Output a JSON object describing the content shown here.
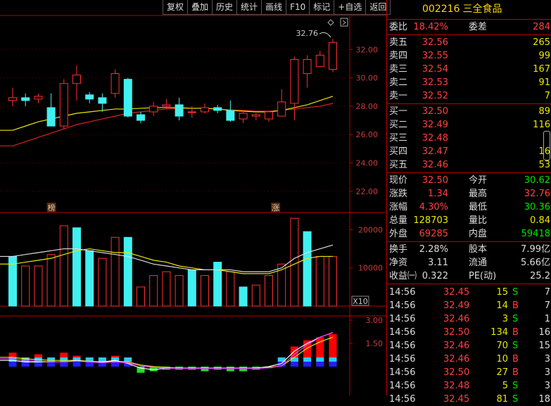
{
  "toolbar": [
    "复权",
    "叠加",
    "历史",
    "统计",
    "画线",
    "F10",
    "标记",
    "+自选",
    "返回"
  ],
  "price_chart": {
    "axis_labels": [
      "32.00",
      "30.00",
      "28.00",
      "26.00",
      "24.00",
      "22.00"
    ],
    "high_marker": "32.76",
    "badges": [
      "榜",
      "涨"
    ],
    "candles": [
      [
        28.4,
        28.6,
        28.0,
        29.3
      ],
      [
        28.6,
        28.4,
        28.0,
        28.9
      ],
      [
        28.5,
        28.7,
        28.2,
        28.9
      ],
      [
        27.9,
        26.6,
        26.6,
        28.9
      ],
      [
        26.6,
        29.6,
        26.4,
        29.9
      ],
      [
        29.6,
        30.2,
        28.4,
        30.9
      ],
      [
        28.8,
        28.5,
        28.2,
        29.0
      ],
      [
        28.6,
        28.2,
        27.6,
        28.9
      ],
      [
        28.9,
        30.3,
        28.6,
        30.6
      ],
      [
        29.9,
        27.3,
        27.2,
        30.0
      ],
      [
        27.4,
        27.0,
        26.8,
        27.6
      ],
      [
        27.6,
        28.0,
        27.3,
        28.3
      ],
      [
        28.0,
        28.1,
        27.8,
        28.5
      ],
      [
        28.1,
        27.3,
        27.0,
        28.6
      ],
      [
        27.6,
        27.6,
        27.2,
        28.0
      ],
      [
        27.6,
        27.9,
        27.5,
        28.2
      ],
      [
        27.9,
        27.7,
        27.5,
        28.1
      ],
      [
        27.7,
        27.0,
        26.9,
        28.4
      ],
      [
        27.1,
        27.5,
        26.8,
        27.7
      ],
      [
        27.3,
        27.4,
        27.0,
        27.5
      ],
      [
        27.1,
        27.6,
        26.9,
        27.6
      ],
      [
        27.3,
        28.3,
        27.3,
        29.2
      ],
      [
        28.2,
        31.3,
        27.0,
        31.5
      ],
      [
        30.3,
        31.3,
        29.3,
        31.6
      ],
      [
        30.8,
        31.6,
        30.8,
        31.9
      ],
      [
        30.6,
        32.5,
        30.4,
        32.76
      ]
    ],
    "ma_yellow": [
      26.3,
      26.6,
      26.9,
      27.1,
      27.3,
      27.5,
      27.6,
      27.7,
      27.8,
      27.8,
      27.85,
      27.9,
      27.9,
      27.9,
      27.85,
      27.85,
      27.8,
      27.7,
      27.65,
      27.6,
      27.6,
      27.7,
      27.9,
      28.1,
      28.4,
      28.7
    ],
    "ma_red": [
      25.2,
      25.5,
      25.8,
      26.1,
      26.4,
      26.7,
      26.9,
      27.1,
      27.3,
      27.5,
      27.6,
      27.7,
      27.8,
      27.85,
      27.85,
      27.85,
      27.8,
      27.75,
      27.7,
      27.65,
      27.65,
      27.7,
      27.8,
      27.9,
      28.0,
      28.2
    ]
  },
  "volume_chart": {
    "axis_labels": [
      "20000",
      "10000"
    ],
    "unit": "X10",
    "bars": [
      [
        13000,
        "down"
      ],
      [
        10500,
        "up"
      ],
      [
        10500,
        "up"
      ],
      [
        13500,
        "up"
      ],
      [
        21000,
        "up"
      ],
      [
        20500,
        "down"
      ],
      [
        14500,
        "down"
      ],
      [
        12500,
        "up"
      ],
      [
        18000,
        "up"
      ],
      [
        18000,
        "down"
      ],
      [
        5000,
        "up"
      ],
      [
        8000,
        "up"
      ],
      [
        9000,
        "up"
      ],
      [
        8000,
        "up"
      ],
      [
        9500,
        "down"
      ],
      [
        8000,
        "up"
      ],
      [
        11500,
        "down"
      ],
      [
        9000,
        "up"
      ],
      [
        5000,
        "down"
      ],
      [
        5500,
        "up"
      ],
      [
        8000,
        "up"
      ],
      [
        11000,
        "up"
      ],
      [
        23000,
        "up"
      ],
      [
        19500,
        "down"
      ],
      [
        13000,
        "up"
      ],
      [
        13000,
        "up"
      ]
    ],
    "ma_yellow": [
      11000,
      11500,
      12000,
      12500,
      13500,
      14500,
      15000,
      14500,
      14000,
      14000,
      13000,
      12000,
      11500,
      10500,
      10000,
      9500,
      9500,
      9000,
      8500,
      8500,
      8500,
      9500,
      11000,
      12500,
      13000,
      13000
    ],
    "ma_white": [
      13000,
      13500,
      14000,
      14500,
      15000,
      15000,
      14500,
      14000,
      13500,
      13000,
      12000,
      11000,
      10500,
      10000,
      9500,
      9500,
      9500,
      9500,
      9000,
      9000,
      9000,
      10000,
      12500,
      14000,
      15000,
      16000
    ]
  },
  "macd_chart": {
    "axis_labels": [
      "3.00",
      "1.50"
    ],
    "hist": [
      0.9,
      0.5,
      0.8,
      0.2,
      0.9,
      0.7,
      0.2,
      0.5,
      0.7,
      0.3,
      -0.4,
      -0.3,
      -0.2,
      -0.2,
      -0.2,
      -0.3,
      -0.2,
      -0.3,
      -0.3,
      -0.2,
      -0.1,
      0.2,
      1.3,
      1.7,
      1.9,
      2.1
    ],
    "line_white": [
      0.4,
      0.3,
      0.3,
      0.3,
      0.3,
      0.4,
      0.3,
      0.3,
      0.4,
      0.2,
      -0.1,
      -0.2,
      -0.1,
      -0.1,
      -0.1,
      -0.1,
      -0.1,
      -0.1,
      -0.1,
      -0.1,
      0.0,
      0.2,
      1.0,
      1.5,
      1.9,
      2.2
    ],
    "line_yellow": [
      0.6,
      0.5,
      0.45,
      0.4,
      0.4,
      0.4,
      0.35,
      0.3,
      0.35,
      0.3,
      0.1,
      0.0,
      -0.05,
      -0.1,
      -0.1,
      -0.1,
      -0.1,
      -0.1,
      -0.1,
      -0.1,
      -0.05,
      0.05,
      0.6,
      1.2,
      1.6,
      1.9
    ],
    "line_mag": [
      0.5,
      0.4,
      0.35,
      0.3,
      0.3,
      0.35,
      0.3,
      0.25,
      0.3,
      0.25,
      0.05,
      -0.05,
      -0.1,
      -0.12,
      -0.12,
      -0.12,
      -0.12,
      -0.12,
      -0.12,
      -0.12,
      -0.08,
      0.05,
      0.8,
      1.4,
      1.9,
      2.2
    ]
  },
  "panel": {
    "code": "002216",
    "name": "三全食品",
    "weibi": {
      "label": "委比",
      "value": "18.42%",
      "label2": "委差",
      "value2": "284"
    },
    "asks": [
      {
        "label": "卖五",
        "price": "32.56",
        "vol": "265"
      },
      {
        "label": "卖四",
        "price": "32.55",
        "vol": "99"
      },
      {
        "label": "卖三",
        "price": "32.54",
        "vol": "167"
      },
      {
        "label": "卖二",
        "price": "32.53",
        "vol": "91"
      },
      {
        "label": "卖一",
        "price": "32.52",
        "vol": "7"
      }
    ],
    "bids": [
      {
        "label": "买一",
        "price": "32.50",
        "vol": "89"
      },
      {
        "label": "买二",
        "price": "32.49",
        "vol": "116"
      },
      {
        "label": "买三",
        "price": "32.48",
        "vol": ""
      },
      {
        "label": "买四",
        "price": "32.47",
        "vol": "16"
      },
      {
        "label": "买五",
        "price": "32.46",
        "vol": "53"
      }
    ],
    "quote": [
      {
        "l1": "现价",
        "v1": "32.50",
        "c1": "red",
        "l2": "今开",
        "v2": "30.62",
        "c2": "green"
      },
      {
        "l1": "涨跌",
        "v1": "1.34",
        "c1": "red",
        "l2": "最高",
        "v2": "32.76",
        "c2": "red"
      },
      {
        "l1": "涨幅",
        "v1": "4.30%",
        "c1": "red",
        "l2": "最低",
        "v2": "30.36",
        "c2": "green"
      },
      {
        "l1": "总量",
        "v1": "128703",
        "c1": "yellow",
        "l2": "量比",
        "v2": "0.84",
        "c2": "yellow"
      },
      {
        "l1": "外盘",
        "v1": "69285",
        "c1": "red",
        "l2": "内盘",
        "v2": "59418",
        "c2": "green"
      }
    ],
    "fund": [
      {
        "l1": "换手",
        "v1": "2.28%",
        "l2": "股本",
        "v2": "7.99亿"
      },
      {
        "l1": "净资",
        "v1": "3.11",
        "l2": "流通",
        "v2": "5.66亿"
      },
      {
        "l1": "收益㈠",
        "v1": "0.322",
        "l2": "PE(动)",
        "v2": "25.2"
      }
    ],
    "ticks": [
      {
        "time": "14:56",
        "price": "32.45",
        "pc": "red",
        "vol": "15",
        "bs": "S",
        "n": "7"
      },
      {
        "time": "14:56",
        "price": "32.49",
        "pc": "red",
        "vol": "14",
        "bs": "B",
        "n": "7"
      },
      {
        "time": "14:56",
        "price": "32.46",
        "pc": "red",
        "vol": "3",
        "bs": "S",
        "n": "1"
      },
      {
        "time": "14:56",
        "price": "32.50",
        "pc": "red",
        "vol": "134",
        "bs": "B",
        "n": "16"
      },
      {
        "time": "14:56",
        "price": "32.46",
        "pc": "red",
        "vol": "70",
        "bs": "S",
        "n": "15"
      },
      {
        "time": "14:56",
        "price": "32.46",
        "pc": "red",
        "vol": "10",
        "bs": "B",
        "n": "3"
      },
      {
        "time": "14:56",
        "price": "32.50",
        "pc": "red",
        "vol": "27",
        "bs": "B",
        "n": "3"
      },
      {
        "time": "14:56",
        "price": "32.48",
        "pc": "red",
        "vol": "5",
        "bs": "S",
        "n": "3"
      },
      {
        "time": "14:56",
        "price": "32.45",
        "pc": "red",
        "vol": "81",
        "bs": "S",
        "n": "18"
      }
    ]
  }
}
